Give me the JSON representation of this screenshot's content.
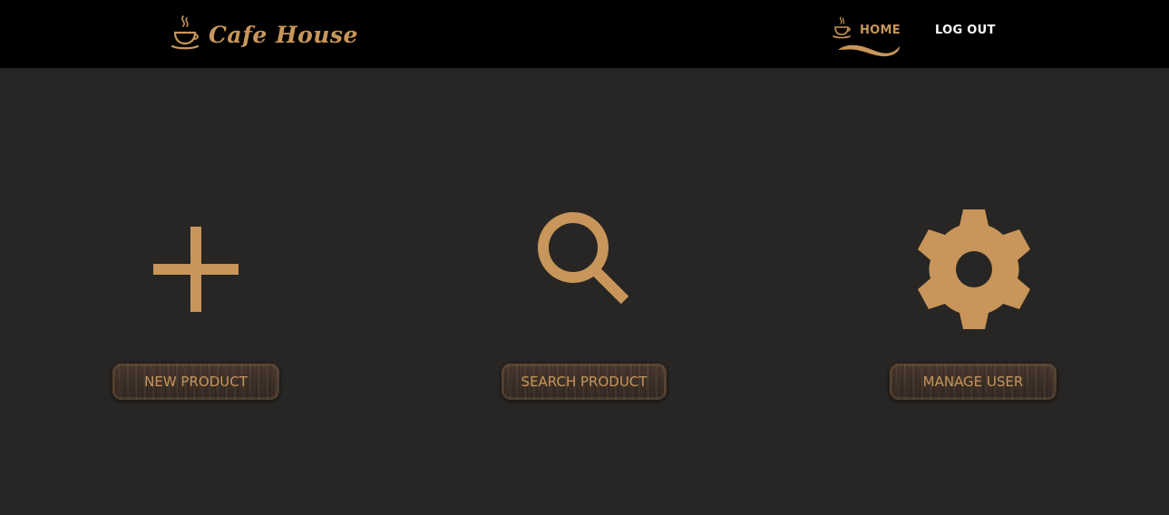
{
  "brand": {
    "name": "Cafe House",
    "icon": "coffee-cup-icon"
  },
  "nav": {
    "home_label": "HOME",
    "home_icon": "coffee-cup-icon",
    "logout_label": "LOG OUT"
  },
  "actions": [
    {
      "label": "NEW PRODUCT",
      "icon": "plus-icon"
    },
    {
      "label": "SEARCH PRODUCT",
      "icon": "search-icon"
    },
    {
      "label": "MANAGE USER",
      "icon": "gear-icon"
    }
  ],
  "colors": {
    "accent": "#c8965a",
    "navbar_bg": "#000000",
    "page_bg": "#282624",
    "button_bg": "#3d3027"
  }
}
